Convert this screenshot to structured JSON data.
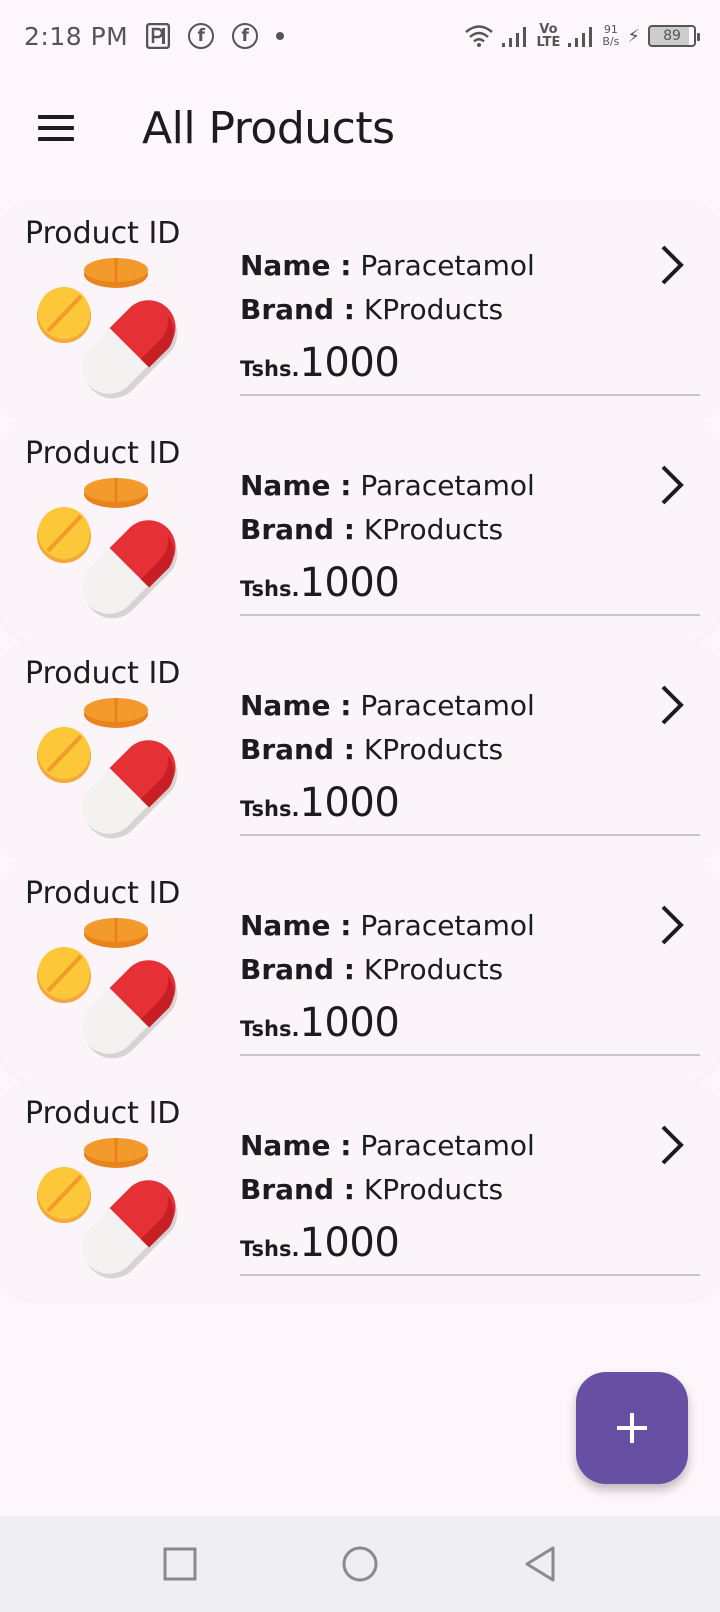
{
  "status_bar": {
    "time": "2:18 PM",
    "volte_top": "Vo",
    "volte_bottom": "LTE",
    "net_speed_value": "91",
    "net_speed_unit": "B/s",
    "battery": "89",
    "icons": [
      "parking-icon",
      "facebook-icon",
      "facebook-icon",
      "dot-icon",
      "wifi-icon",
      "signal-icon",
      "charging-icon",
      "battery-icon"
    ]
  },
  "app_bar": {
    "title": "All Products",
    "menu_icon": "menu-icon"
  },
  "products": [
    {
      "id_label": "Product ID",
      "name_label": "Name :",
      "name": "Paracetamol",
      "brand_label": "Brand :",
      "brand": "KProducts",
      "currency": "Tshs.",
      "price": "1000"
    },
    {
      "id_label": "Product ID",
      "name_label": "Name :",
      "name": "Paracetamol",
      "brand_label": "Brand :",
      "brand": "KProducts",
      "currency": "Tshs.",
      "price": "1000"
    },
    {
      "id_label": "Product ID",
      "name_label": "Name :",
      "name": "Paracetamol",
      "brand_label": "Brand :",
      "brand": "KProducts",
      "currency": "Tshs.",
      "price": "1000"
    },
    {
      "id_label": "Product ID",
      "name_label": "Name :",
      "name": "Paracetamol",
      "brand_label": "Brand :",
      "brand": "KProducts",
      "currency": "Tshs.",
      "price": "1000"
    },
    {
      "id_label": "Product ID",
      "name_label": "Name :",
      "name": "Paracetamol",
      "brand_label": "Brand :",
      "brand": "KProducts",
      "currency": "Tshs.",
      "price": "1000"
    }
  ],
  "fab": {
    "icon": "plus-icon"
  },
  "nav_bar": {
    "icons": [
      "square-icon",
      "circle-icon",
      "back-triangle-icon"
    ]
  },
  "colors": {
    "background": "#fdf7fb",
    "fab": "#6750a4",
    "pill_red": "#e53035",
    "pill_white": "#f4f1f1",
    "tablet_yellow": "#fdc73a",
    "tablet_orange": "#e8821a"
  }
}
